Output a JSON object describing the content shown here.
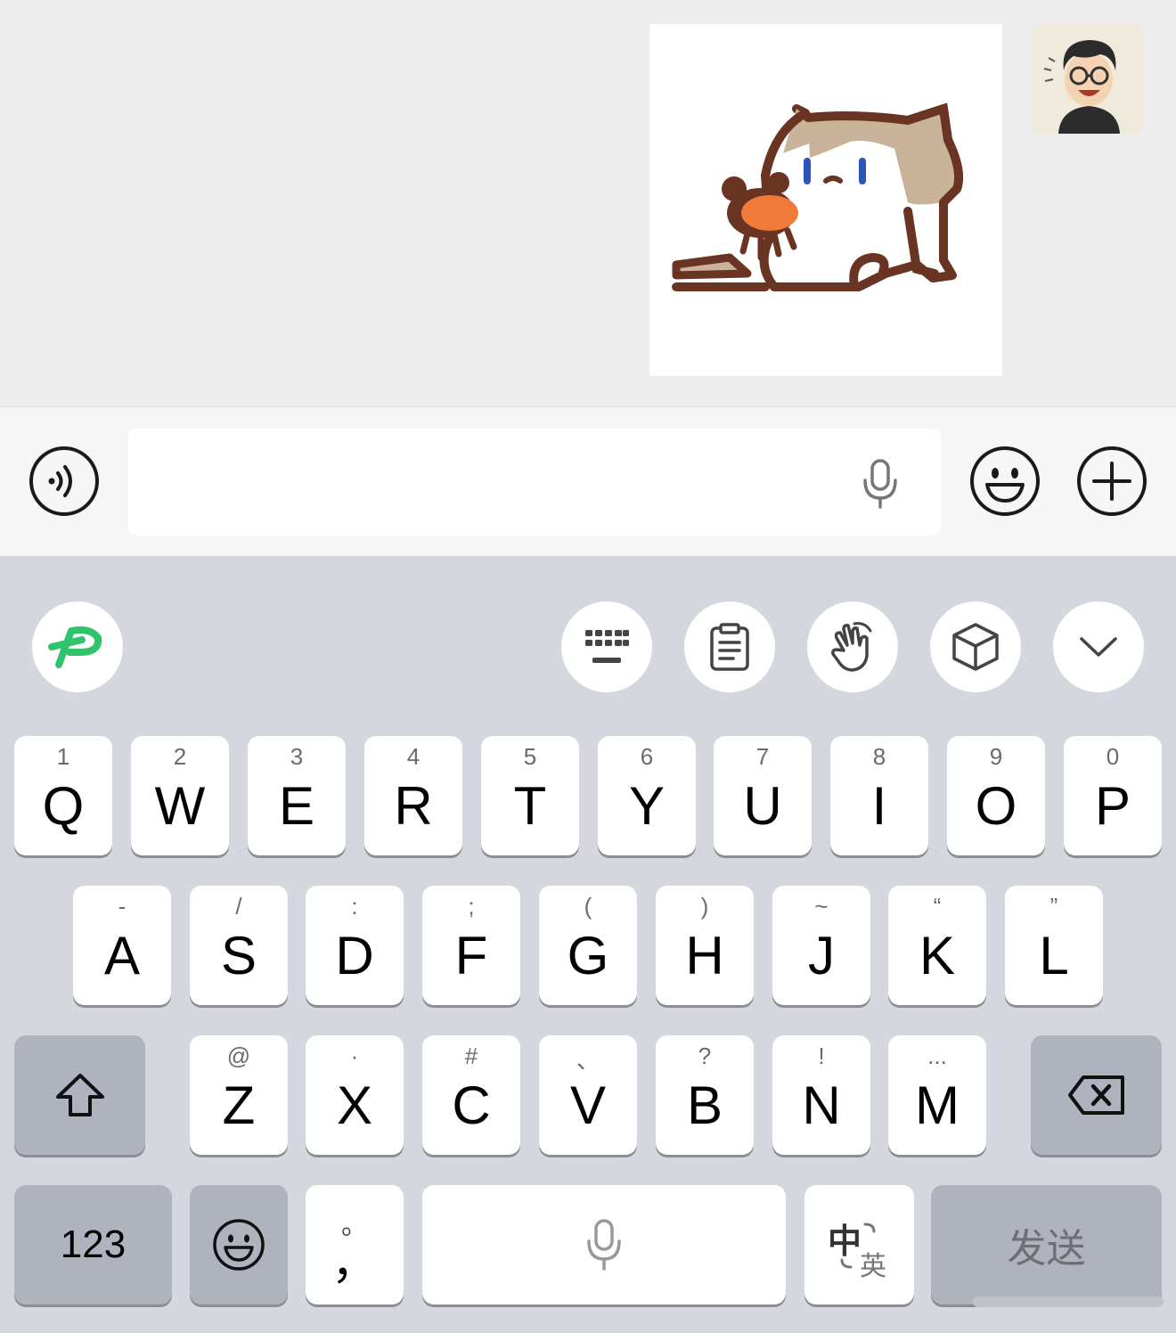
{
  "chat": {
    "sticker_icon": "cat-holding-crab-sticker",
    "avatar_icon": "cartoon-man-avatar"
  },
  "input_bar": {
    "voice_toggle_icon": "voice-wave-icon",
    "text_value": "",
    "field_mic_icon": "microphone-icon",
    "emoji_icon": "smiley-icon",
    "plus_icon": "plus-circle-icon"
  },
  "toolbar": {
    "logo_icon": "input-method-logo-icon",
    "buttons": [
      {
        "icon": "keyboard-layout-icon"
      },
      {
        "icon": "clipboard-icon"
      },
      {
        "icon": "hand-gesture-icon"
      },
      {
        "icon": "cube-icon"
      },
      {
        "icon": "chevron-down-icon"
      }
    ]
  },
  "keys": {
    "row1": [
      {
        "main": "Q",
        "hint": "1"
      },
      {
        "main": "W",
        "hint": "2"
      },
      {
        "main": "E",
        "hint": "3"
      },
      {
        "main": "R",
        "hint": "4"
      },
      {
        "main": "T",
        "hint": "5"
      },
      {
        "main": "Y",
        "hint": "6"
      },
      {
        "main": "U",
        "hint": "7"
      },
      {
        "main": "I",
        "hint": "8"
      },
      {
        "main": "O",
        "hint": "9"
      },
      {
        "main": "P",
        "hint": "0"
      }
    ],
    "row2": [
      {
        "main": "A",
        "hint": "-"
      },
      {
        "main": "S",
        "hint": "/"
      },
      {
        "main": "D",
        "hint": ":"
      },
      {
        "main": "F",
        "hint": ";"
      },
      {
        "main": "G",
        "hint": "("
      },
      {
        "main": "H",
        "hint": ")"
      },
      {
        "main": "J",
        "hint": "~"
      },
      {
        "main": "K",
        "hint": "“"
      },
      {
        "main": "L",
        "hint": "”"
      }
    ],
    "row3": [
      {
        "main": "Z",
        "hint": "@"
      },
      {
        "main": "X",
        "hint": "·"
      },
      {
        "main": "C",
        "hint": "#"
      },
      {
        "main": "V",
        "hint": "、"
      },
      {
        "main": "B",
        "hint": "?"
      },
      {
        "main": "N",
        "hint": "!"
      },
      {
        "main": "M",
        "hint": "..."
      }
    ],
    "shift_icon": "shift-arrow-icon",
    "backspace_icon": "backspace-icon",
    "numbers_label": "123",
    "emoji_key_icon": "smiley-icon",
    "punct_main": "，",
    "punct_hint": "。",
    "space_icon": "microphone-icon",
    "lang_primary": "中",
    "lang_secondary": "英",
    "send_label": "发送"
  },
  "colors": {
    "keyboard_bg": "#d5d7de",
    "key_bg": "#ffffff",
    "dark_key_bg": "#aeb3bd",
    "logo_green": "#2fc46b",
    "send_text": "#6d6f74"
  }
}
